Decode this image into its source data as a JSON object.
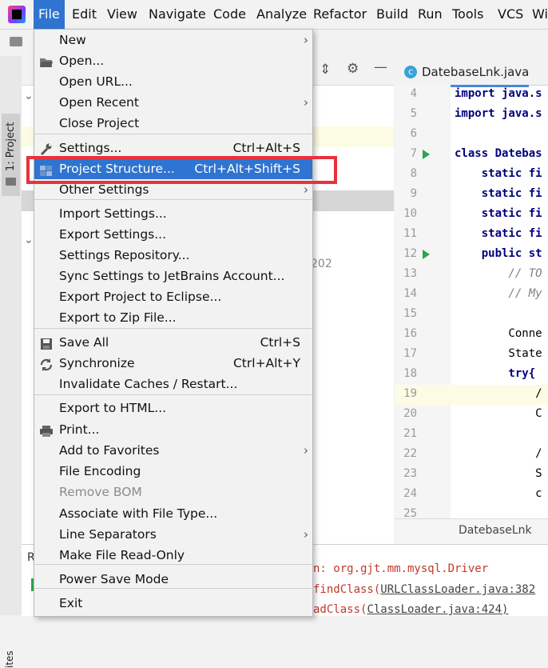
{
  "menubar": {
    "items": [
      "File",
      "Edit",
      "View",
      "Navigate",
      "Code",
      "Analyze",
      "Refactor",
      "Build",
      "Run",
      "Tools",
      "VCS",
      "Wi"
    ]
  },
  "left_strip": {
    "project_tab": "1: Project",
    "bottom_tab": "ites"
  },
  "project_panel": {
    "partial_text": "202"
  },
  "editor": {
    "tab_label": "DatebaseLnk.java",
    "tab_icon": "class-icon",
    "line_numbers": [
      "4",
      "5",
      "6",
      "7",
      "8",
      "9",
      "10",
      "11",
      "12",
      "13",
      "14",
      "15",
      "16",
      "17",
      "18",
      "19",
      "20",
      "21",
      "22",
      "23",
      "24",
      "25"
    ],
    "code_lines": [
      "import java.s",
      "import java.s",
      "",
      "class Datebas",
      "    static fi",
      "    static fi",
      "    static fi",
      "    static fi",
      "    public st",
      "        // TO",
      "        // My",
      "",
      "        Conne",
      "        State",
      "        try{",
      "            /",
      "            C",
      "",
      "            /",
      "            S",
      "            c",
      ""
    ],
    "breadcrumb": "DatebaseLnk"
  },
  "console": {
    "line1": "n: org.gjt.mm.mysql.Driver",
    "line2_prefix": "findClass(",
    "line2_link": "URLClassLoader.java:382",
    "line3_prefix": "adClass(",
    "line3_link": "ClassLoader.java:424)"
  },
  "bottom_panel": {
    "label_r": "R"
  },
  "file_menu": {
    "items": [
      {
        "label": "New",
        "shortcut": "",
        "submenu": true
      },
      {
        "label": "Open...",
        "shortcut": "",
        "submenu": false,
        "icon": "folder-open-icon"
      },
      {
        "label": "Open URL...",
        "shortcut": "",
        "submenu": false
      },
      {
        "label": "Open Recent",
        "shortcut": "",
        "submenu": true
      },
      {
        "label": "Close Project",
        "shortcut": "",
        "submenu": false
      },
      {
        "label": "Settings...",
        "shortcut": "Ctrl+Alt+S",
        "submenu": false,
        "icon": "wrench-icon"
      },
      {
        "label": "Project Structure...",
        "shortcut": "Ctrl+Alt+Shift+S",
        "submenu": false,
        "icon": "project-structure-icon",
        "selected": true
      },
      {
        "label": "Other Settings",
        "shortcut": "",
        "submenu": true
      },
      {
        "label": "Import Settings...",
        "shortcut": "",
        "submenu": false
      },
      {
        "label": "Export Settings...",
        "shortcut": "",
        "submenu": false
      },
      {
        "label": "Settings Repository...",
        "shortcut": "",
        "submenu": false
      },
      {
        "label": "Sync Settings to JetBrains Account...",
        "shortcut": "",
        "submenu": false
      },
      {
        "label": "Export Project to Eclipse...",
        "shortcut": "",
        "submenu": false
      },
      {
        "label": "Export to Zip File...",
        "shortcut": "",
        "submenu": false
      },
      {
        "label": "Save All",
        "shortcut": "Ctrl+S",
        "submenu": false,
        "icon": "save-icon"
      },
      {
        "label": "Synchronize",
        "shortcut": "Ctrl+Alt+Y",
        "submenu": false,
        "icon": "sync-icon"
      },
      {
        "label": "Invalidate Caches / Restart...",
        "shortcut": "",
        "submenu": false
      },
      {
        "label": "Export to HTML...",
        "shortcut": "",
        "submenu": false
      },
      {
        "label": "Print...",
        "shortcut": "",
        "submenu": false,
        "icon": "printer-icon"
      },
      {
        "label": "Add to Favorites",
        "shortcut": "",
        "submenu": true
      },
      {
        "label": "File Encoding",
        "shortcut": "",
        "submenu": false
      },
      {
        "label": "Remove BOM",
        "shortcut": "",
        "submenu": false,
        "disabled": true
      },
      {
        "label": "Associate with File Type...",
        "shortcut": "",
        "submenu": false
      },
      {
        "label": "Line Separators",
        "shortcut": "",
        "submenu": true
      },
      {
        "label": "Make File Read-Only",
        "shortcut": "",
        "submenu": false
      },
      {
        "label": "Power Save Mode",
        "shortcut": "",
        "submenu": false
      },
      {
        "label": "Exit",
        "shortcut": "",
        "submenu": false
      }
    ]
  },
  "colors": {
    "selection": "#2f74d0",
    "highlight_box": "#e8323b",
    "run_gutter": "#2ea44f"
  }
}
